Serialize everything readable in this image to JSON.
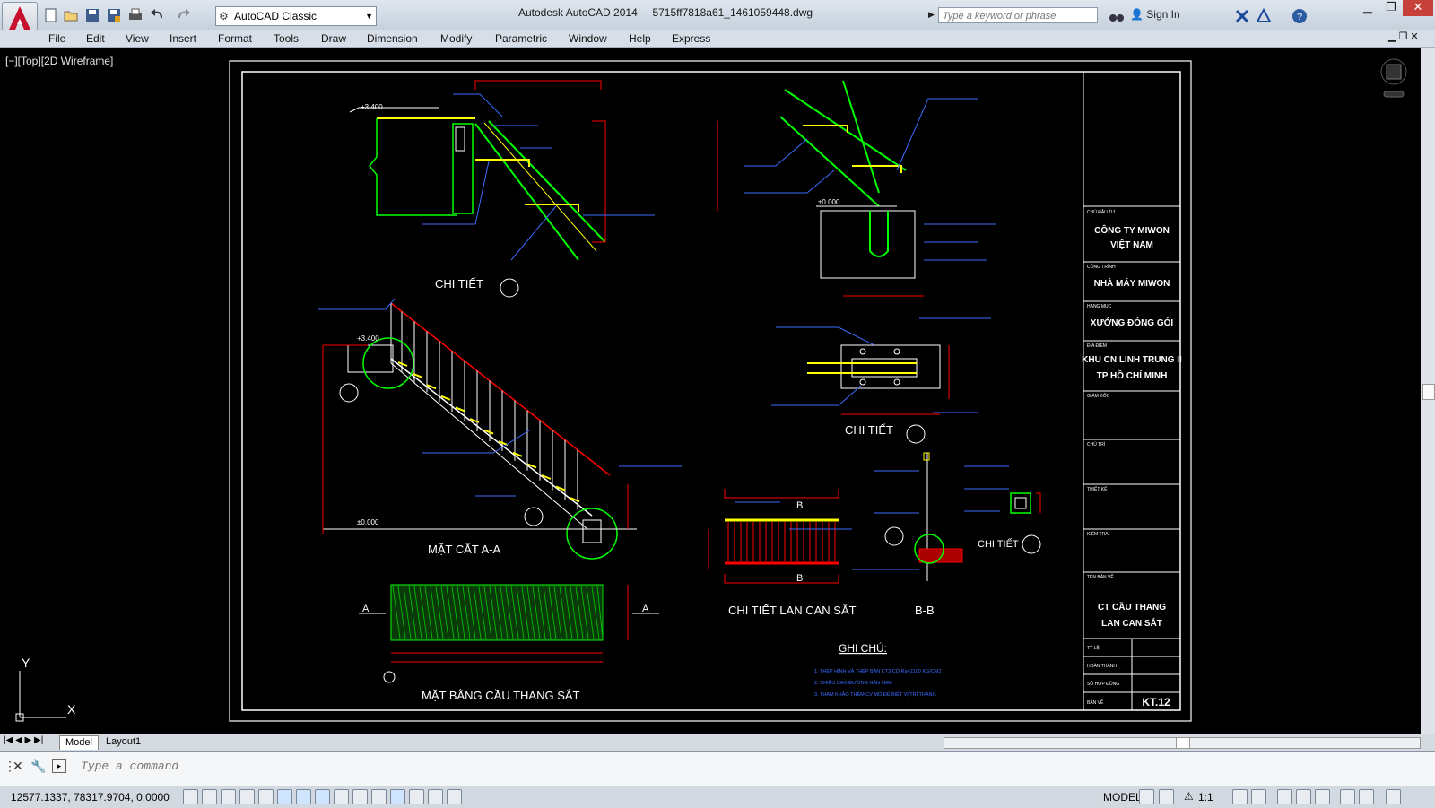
{
  "window": {
    "title_app": "Autodesk AutoCAD 2014",
    "title_file": "5715ff7818a61_1461059448.dwg",
    "workspace": "AutoCAD Classic",
    "search_placeholder": "Type a keyword or phrase",
    "sign_in": "Sign In"
  },
  "menu": [
    "File",
    "Edit",
    "View",
    "Insert",
    "Format",
    "Tools",
    "Draw",
    "Dimension",
    "Modify",
    "Parametric",
    "Window",
    "Help",
    "Express"
  ],
  "viewport": {
    "label": "[−][Top][2D Wireframe]"
  },
  "ucs": {
    "x": "X",
    "y": "Y"
  },
  "drawing": {
    "titles": {
      "detail1": "CHI TIẾT",
      "detail2": "CHI TIẾT",
      "detail3": "CHI TIẾT",
      "section_aa": "MẶT CẮT A-A",
      "plan": "MẶT BẰNG CẦU THANG SẮT",
      "railing": "CHI TIẾT LAN CAN SẮT",
      "section_bb": "B-B",
      "notes_title": "GHI CHÚ:"
    },
    "levels": {
      "top1": "+3.400",
      "top2": "+3.400",
      "ground1": "±0.000",
      "ground2": "±0.000"
    },
    "section_marks": {
      "a_left": "A",
      "a_right": "A",
      "b_top": "B",
      "b_bottom": "B"
    },
    "notes": [
      "1. THÉP HÌNH VÀ THÉP BẢN CT3 CÓ Ra=2100 KG/CM2",
      "2. CHIỀU CAO ĐƯỜNG HÀN 6MM",
      "3. THAM KHẢO THÊM CV MÓ ĐỂ BIẾT VỊ TRÍ THANG"
    ],
    "titleblock": {
      "owner_label": "CHỦ ĐẦU TƯ",
      "owner": [
        "CÔNG TY MIWON",
        "VIỆT NAM"
      ],
      "project_label": "CÔNG TRÌNH",
      "project": "NHÀ MÁY MIWON",
      "item_label": "HẠNG MỤC",
      "item": "XƯỞNG ĐÓNG GÓI",
      "location_label": "ĐỊA ĐIỂM",
      "location": [
        "KHU CN LINH TRUNG II",
        "TP HỒ CHÍ MINH"
      ],
      "director_label": "GIÁM ĐỐC",
      "chief_label": "CHỦ TRÌ",
      "design_label": "THIẾT KẾ",
      "check_label": "KIỂM TRA",
      "sheet_label": "TÊN BẢN VẼ",
      "sheet_name": [
        "CT CẦU THANG",
        "LAN CAN SẮT"
      ],
      "scale_label": "TỶ LỆ",
      "done_label": "HOÀN THÀNH",
      "contract_label": "SỐ HỢP ĐỒNG",
      "drawing_label": "BẢN VẼ",
      "drawing_no": "KT.12"
    }
  },
  "tabs": [
    "Model",
    "Layout1"
  ],
  "command": {
    "placeholder": "Type a command"
  },
  "status": {
    "coords": "12577.1337, 78317.9704, 0.0000",
    "space": "MODEL",
    "scale": "1:1"
  },
  "colors": {
    "line_white": "#ffffff",
    "line_yellow": "#ffff00",
    "line_green": "#00ff00",
    "line_red": "#ff0000",
    "line_blue": "#3c6cff",
    "line_cyan": "#00ffff"
  }
}
